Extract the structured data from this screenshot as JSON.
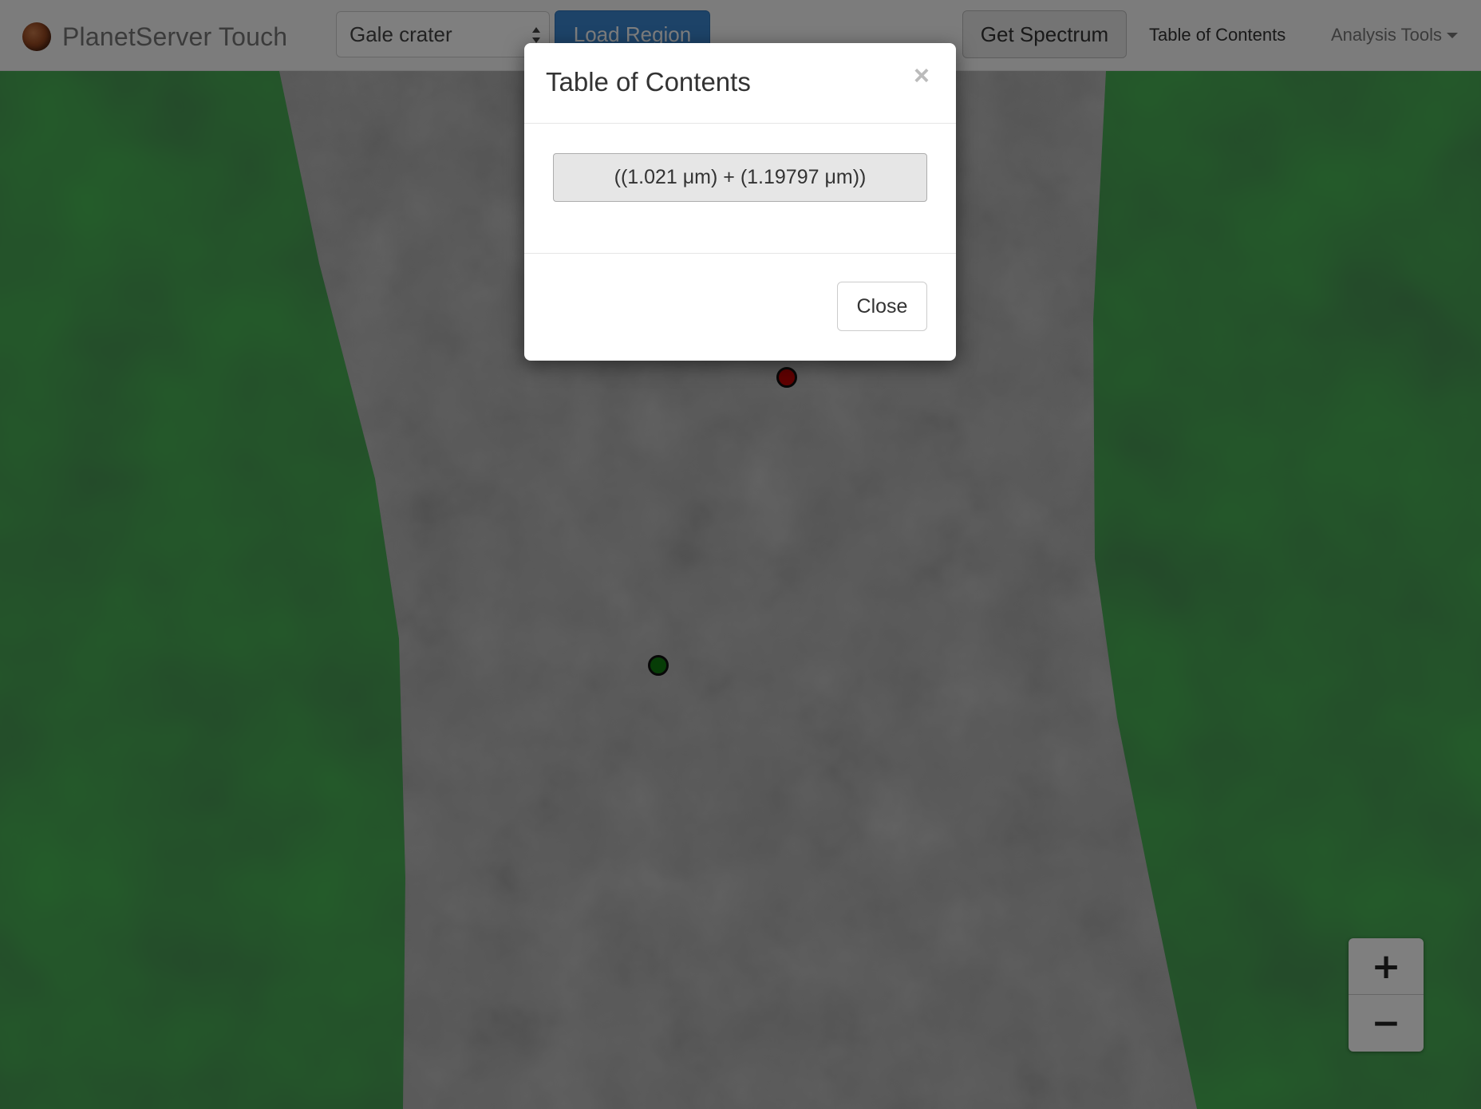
{
  "navbar": {
    "brand": "PlanetServer Touch",
    "region_select_value": "Gale crater",
    "load_region_label": "Load Region",
    "get_spectrum_label": "Get Spectrum",
    "table_of_contents_label": "Table of Contents",
    "analysis_tools_label": "Analysis Tools"
  },
  "map": {
    "zoom_in_label": "+",
    "zoom_out_label": "−",
    "markers": [
      {
        "name": "red-marker",
        "color": "#c00000"
      },
      {
        "name": "green-marker",
        "color": "#0f7a0f"
      }
    ]
  },
  "modal": {
    "title": "Table of Contents",
    "close_x": "×",
    "toc_item": "((1.021 μm) + (1.19797 μm))",
    "close_button_label": "Close"
  },
  "colors": {
    "accent_blue": "#3a86d0",
    "vegetation_green": "#2e6b35",
    "terrain_gray": "#8a8a8a"
  }
}
